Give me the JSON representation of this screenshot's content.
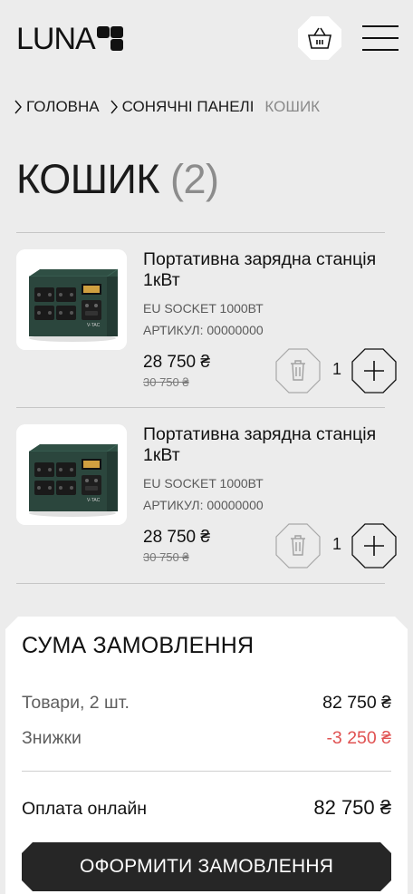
{
  "header": {
    "logo_text": "LUNA",
    "icons": {
      "cart": "basket-icon",
      "menu": "hamburger-menu-icon"
    }
  },
  "breadcrumb": [
    {
      "label": "ГОЛОВНА"
    },
    {
      "label": "СОНЯЧНІ ПАНЕЛІ"
    },
    {
      "label": "КОШИК"
    }
  ],
  "page": {
    "title": "КОШИК",
    "count": "(2)"
  },
  "cart_items": [
    {
      "name": "Портативна зарядна станція 1кВт",
      "socket": "EU SOCKET 1000ВТ",
      "sku": "АРТИКУЛ: 00000000",
      "price": "28 750 ₴",
      "old_price": "30 750 ₴",
      "quantity": "1",
      "product_badge": "V-TAC"
    },
    {
      "name": "Портативна зарядна станція 1кВт",
      "socket": "EU SOCKET 1000ВТ",
      "sku": "АРТИКУЛ: 00000000",
      "price": "28 750 ₴",
      "old_price": "30 750 ₴",
      "quantity": "1",
      "product_badge": "V-TAC"
    }
  ],
  "summary": {
    "title": "СУМА ЗАМОВЛЕННЯ",
    "goods_label": "Товари, 2 шт.",
    "goods_value": "82 750 ₴",
    "discount_label": "Знижки",
    "discount_value": "-3 250 ₴",
    "total_label": "Оплата онлайн",
    "total_value": "82 750 ₴",
    "checkout_label": "ОФОРМИТИ ЗАМОВЛЕННЯ"
  },
  "colors": {
    "background": "#ececec",
    "discount": "#e05252",
    "button": "#262626",
    "product_green": "#2f4f44"
  }
}
